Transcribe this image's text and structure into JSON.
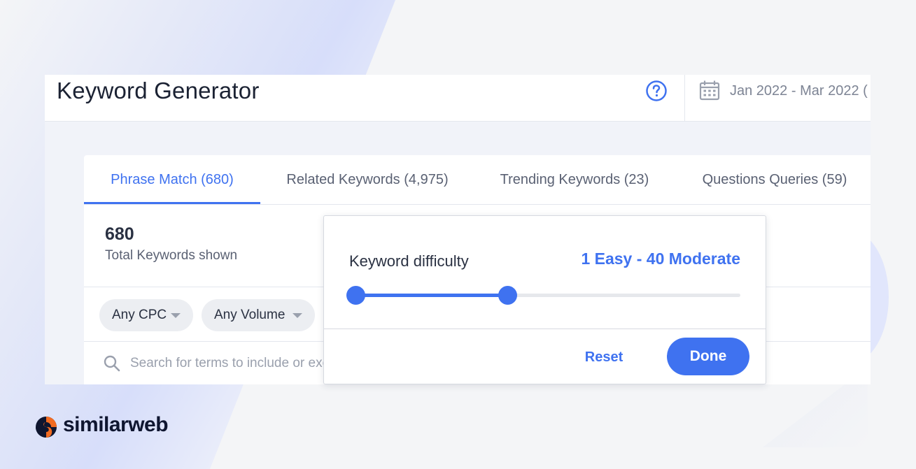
{
  "header": {
    "title": "Keyword Generator",
    "date_range": "Jan 2022 - Mar 2022 ("
  },
  "tabs": [
    {
      "label": "Phrase Match (680)",
      "active": true
    },
    {
      "label": "Related Keywords (4,975)",
      "active": false
    },
    {
      "label": "Trending Keywords (23)",
      "active": false
    },
    {
      "label": "Questions Queries (59)",
      "active": false
    }
  ],
  "summary": {
    "count": "680",
    "label": "Total Keywords shown"
  },
  "filters": {
    "cpc": "Any CPC",
    "volume": "Any Volume"
  },
  "search": {
    "placeholder": "Search for terms to include or exclude"
  },
  "difficulty_popover": {
    "label": "Keyword difficulty",
    "value_text": "1 Easy - 40 Moderate",
    "range_min": 1,
    "range_max": 40,
    "scale_max": 100,
    "reset_label": "Reset",
    "done_label": "Done"
  },
  "brand": {
    "name": "similarweb",
    "accent_color": "#3f72f0",
    "logo_orange": "#f26b21"
  }
}
